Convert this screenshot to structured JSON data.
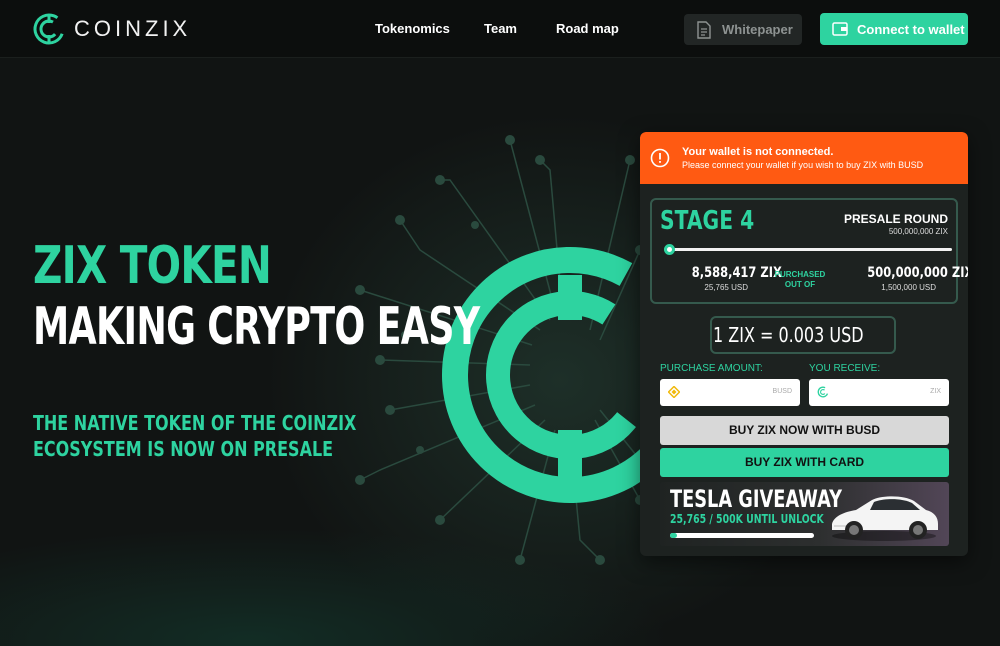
{
  "brand": {
    "name": "COINZIX",
    "accent": "#2ed3a0",
    "warning": "#ff5a12"
  },
  "header": {
    "nav": [
      "Tokenomics",
      "Team",
      "Road map"
    ],
    "whitepaper_label": "Whitepaper",
    "connect_label": "Connect to wallet"
  },
  "hero": {
    "title": "ZIX TOKEN",
    "subtitle": "MAKING CRYPTO EASY",
    "desc_line1": "THE NATIVE TOKEN OF THE COINZIX",
    "desc_line2": "ECOSYSTEM IS NOW ON PRESALE"
  },
  "alert": {
    "title": "Your wallet is not connected.",
    "text": "Please connect your wallet if you wish to buy ZIX with BUSD",
    "icon": "warning-circle-icon"
  },
  "presale": {
    "stage": "STAGE 4",
    "round_label": "PRESALE ROUND",
    "round_amount": "500,000,000 ZIX",
    "progress_fraction": 0.017,
    "purchased_value": "8,588,417 ZIX",
    "purchased_usd": "25,765 USD",
    "mid_line1": "PURCHASED",
    "mid_line2": "OUT OF",
    "total_value": "500,000,000 ZIX",
    "total_usd": "1,500,000 USD",
    "rate": "1 ZIX = 0.003 USD"
  },
  "purchase": {
    "amount_label": "PURCHASE AMOUNT:",
    "receive_label": "YOU RECEIVE:",
    "amount_value": "",
    "receive_value": "",
    "amount_unit": "BUSD",
    "receive_unit": "ZIX",
    "busd_button": "BUY ZIX NOW WITH BUSD",
    "card_button": "BUY ZIX WITH CARD"
  },
  "giveaway": {
    "title": "TESLA GIVEAWAY",
    "progress_text": "25,765 / 500K UNTIL UNLOCK",
    "progress_fraction": 0.05
  }
}
